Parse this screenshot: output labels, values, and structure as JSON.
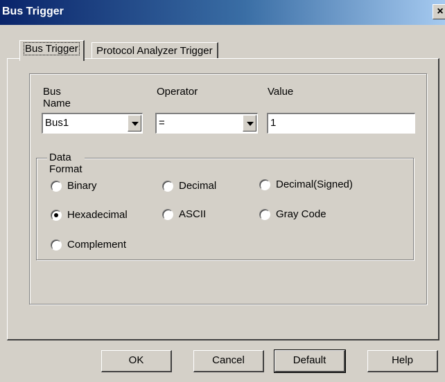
{
  "window": {
    "title": "Bus Trigger",
    "close_glyph": "×"
  },
  "tabs": [
    {
      "label": "Bus Trigger",
      "active": true
    },
    {
      "label": "Protocol Analyzer Trigger",
      "active": false
    }
  ],
  "fields": {
    "bus_name": {
      "label": "Bus Name",
      "value": "Bus1"
    },
    "operator": {
      "label": "Operator",
      "value": "="
    },
    "value": {
      "label": "Value",
      "value": "1"
    }
  },
  "data_format": {
    "legend": "Data Format",
    "options": [
      {
        "label": "Binary",
        "checked": false
      },
      {
        "label": "Decimal",
        "checked": false
      },
      {
        "label": "Decimal(Signed)",
        "checked": false
      },
      {
        "label": "Hexadecimal",
        "checked": true
      },
      {
        "label": "ASCII",
        "checked": false
      },
      {
        "label": "Gray Code",
        "checked": false
      },
      {
        "label": "Complement",
        "checked": false
      }
    ]
  },
  "buttons": {
    "ok": "OK",
    "cancel": "Cancel",
    "default": "Default",
    "help": "Help"
  }
}
